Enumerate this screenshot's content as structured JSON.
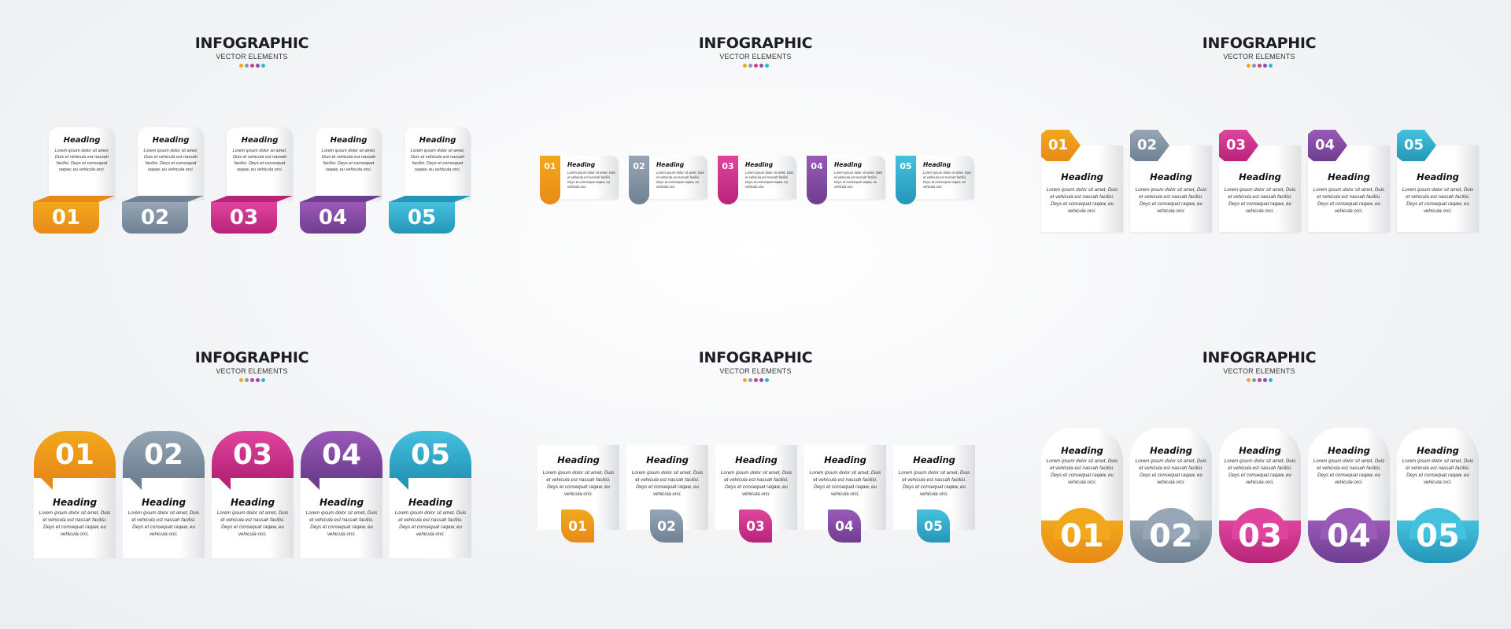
{
  "palette": {
    "yellow": "#f2a81d",
    "gray": "#8a9aab",
    "magenta": "#d53a91",
    "purple": "#8a4fa8",
    "cyan": "#34b3d3"
  },
  "title": {
    "main": "INFOGRAPHIC",
    "sub": "VECTOR ELEMENTS",
    "dot_colors": [
      "#f2a81d",
      "#8a9aab",
      "#d53a91",
      "#8a4fa8",
      "#34b3d3"
    ]
  },
  "steps": [
    {
      "number": "01",
      "heading": "Heading",
      "color": "#f2a81d",
      "color_dark": "#e88a17"
    },
    {
      "number": "02",
      "heading": "Heading",
      "color": "#97a6b6",
      "color_dark": "#6f8193"
    },
    {
      "number": "03",
      "heading": "Heading",
      "color": "#e0459d",
      "color_dark": "#b8237a"
    },
    {
      "number": "04",
      "heading": "Heading",
      "color": "#9a5ab8",
      "color_dark": "#6e3d90"
    },
    {
      "number": "05",
      "heading": "Heading",
      "color": "#45c1dd",
      "color_dark": "#2596b8"
    }
  ],
  "body_text": "Lorem ipsum dolor sit amet, Duis et vehicula est nassah facilisi. Deys et consequat raqaw, eu vehicula orci.",
  "panels": [
    {
      "id": "p1",
      "style": "folded-tab-bottom"
    },
    {
      "id": "p2",
      "style": "side-ribbon"
    },
    {
      "id": "p3",
      "style": "arrow-tag-top"
    },
    {
      "id": "p4",
      "style": "speech-bubble-top"
    },
    {
      "id": "p5",
      "style": "leaf-badge-bottom"
    },
    {
      "id": "p6",
      "style": "pill-bottom"
    }
  ]
}
